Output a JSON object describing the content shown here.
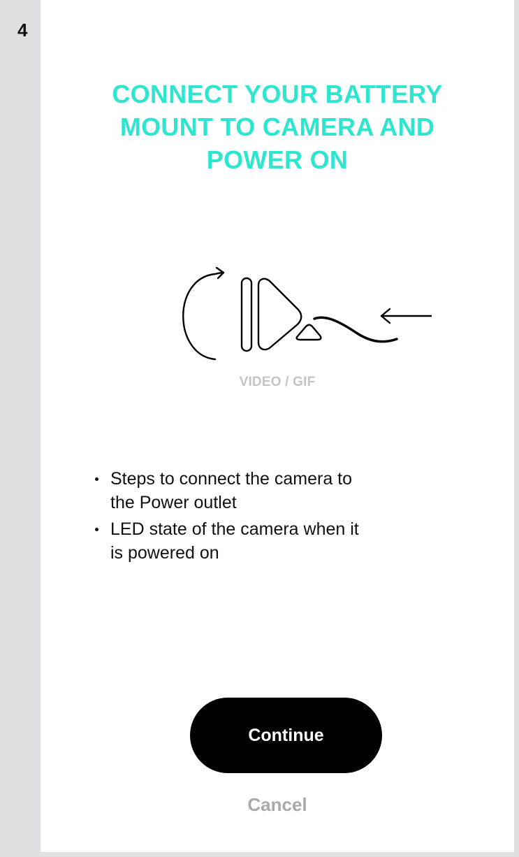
{
  "step": {
    "number": "4"
  },
  "header": {
    "title_lines": [
      "CONNECT YOUR BATTERY",
      "MOUNT TO CAMERA AND",
      "POWER ON"
    ]
  },
  "media": {
    "icon": "camera-battery-connect-illustration",
    "label": "VIDEO / GIF"
  },
  "instructions": {
    "items": [
      {
        "line1": "Steps to connect the camera to",
        "line2": "the Power outlet"
      },
      {
        "line1": "LED state of the camera when it",
        "line2": "is powered on"
      }
    ]
  },
  "actions": {
    "continue_label": "Continue",
    "cancel_label": "Cancel"
  },
  "colors": {
    "accent": "#2EE6CF",
    "button": "#000000",
    "muted": "#A9A9A9",
    "background": "#E0E0E2"
  }
}
